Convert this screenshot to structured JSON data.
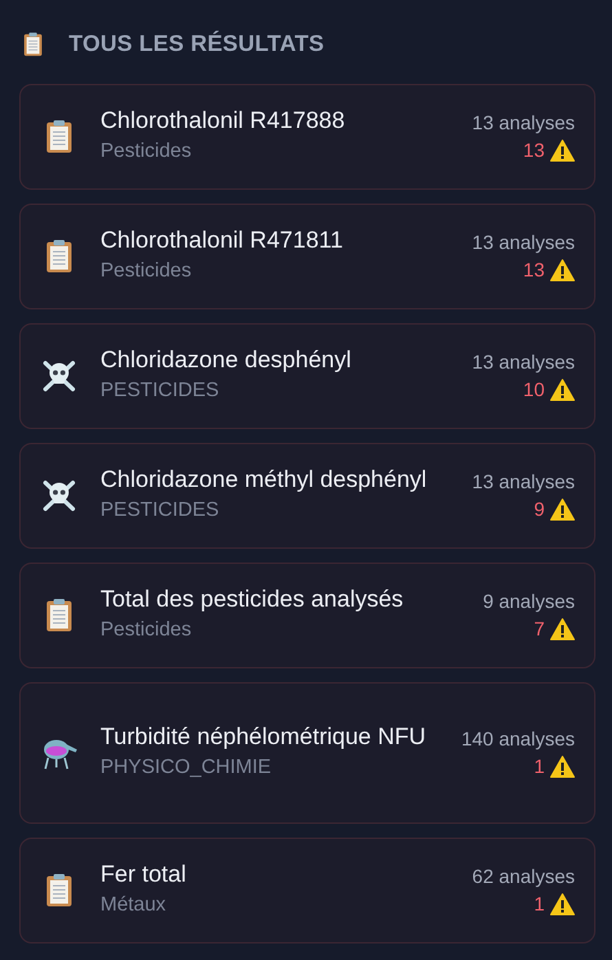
{
  "header": {
    "title": "TOUS LES RÉSULTATS"
  },
  "results": [
    {
      "kind": "clipboard",
      "name": "Chlorothalonil R417888",
      "category": "Pesticides",
      "analyses": "13 analyses",
      "alerts": "13"
    },
    {
      "kind": "clipboard",
      "name": "Chlorothalonil R471811",
      "category": "Pesticides",
      "analyses": "13 analyses",
      "alerts": "13"
    },
    {
      "kind": "skull",
      "name": "Chloridazone desphényl",
      "category": "PESTICIDES",
      "analyses": "13 analyses",
      "alerts": "10"
    },
    {
      "kind": "skull",
      "name": "Chloridazone méthyl desphényl",
      "category": "PESTICIDES",
      "analyses": "13 analyses",
      "alerts": "9"
    },
    {
      "kind": "clipboard",
      "name": "Total des pesticides analysés",
      "category": "Pesticides",
      "analyses": "9 analyses",
      "alerts": "7"
    },
    {
      "kind": "flask",
      "name": "Turbidité néphélométrique NFU",
      "category": "PHYSICO_CHIMIE",
      "analyses": "140 analyses",
      "alerts": "1"
    },
    {
      "kind": "clipboard",
      "name": "Fer total",
      "category": "Métaux",
      "analyses": "62 analyses",
      "alerts": "1"
    }
  ]
}
